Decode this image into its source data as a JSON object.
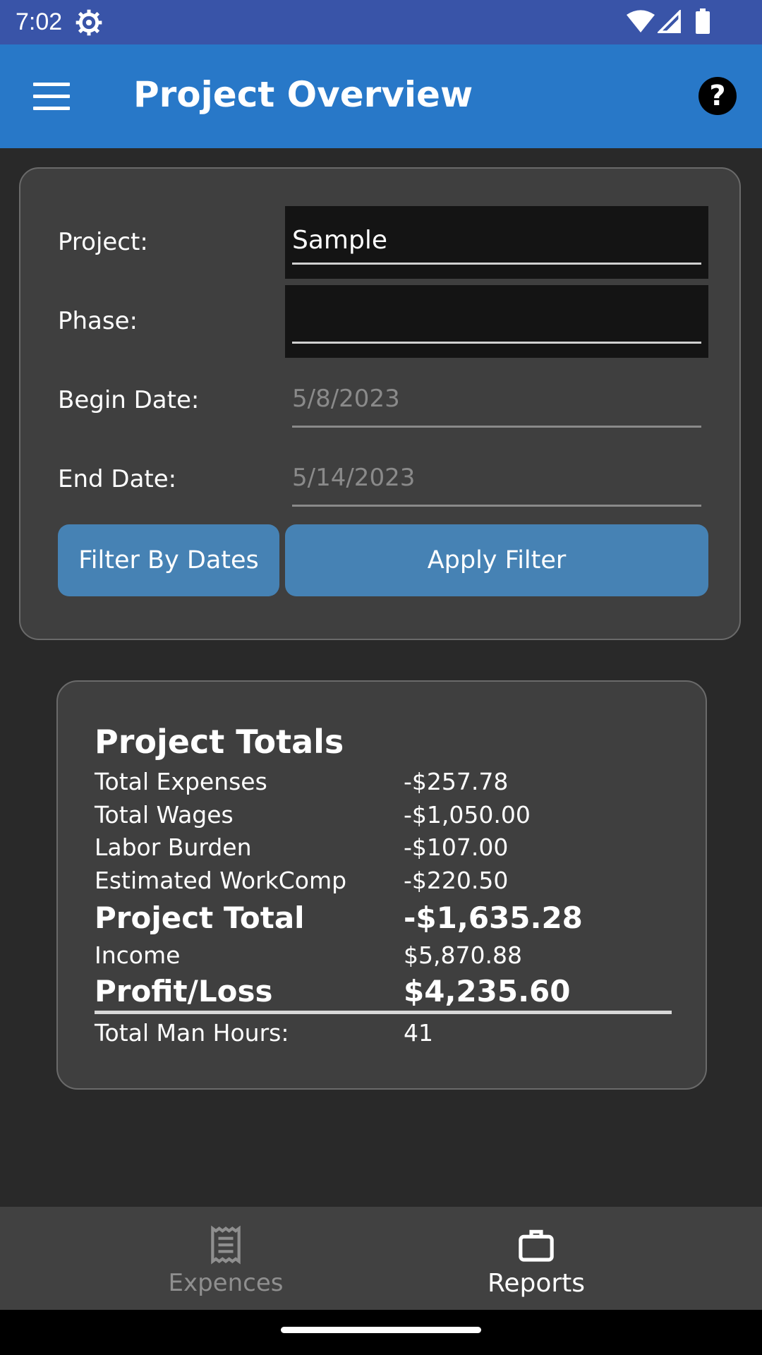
{
  "status": {
    "time": "7:02",
    "icons": [
      "gear-icon",
      "wifi-icon",
      "signal-icon",
      "battery-icon"
    ]
  },
  "appbar": {
    "title": "Project Overview",
    "menu_icon": "hamburger-menu-icon",
    "help_icon": "help-icon",
    "help_glyph": "?"
  },
  "filter": {
    "project_label": "Project:",
    "project_value": "Sample",
    "phase_label": "Phase:",
    "phase_value": "",
    "begin_label": "Begin Date:",
    "begin_value": "5/8/2023",
    "end_label": "End Date:",
    "end_value": "5/14/2023",
    "filter_dates_button": "Filter By Dates",
    "apply_button": "Apply Filter"
  },
  "totals": {
    "title": "Project Totals",
    "rows": [
      {
        "label": "Total Expenses",
        "value": "-$257.78"
      },
      {
        "label": "Total Wages",
        "value": "-$1,050.00"
      },
      {
        "label": "Labor Burden",
        "value": "-$107.00"
      },
      {
        "label": "Estimated WorkComp",
        "value": "-$220.50"
      },
      {
        "label": "Project Total",
        "value": "-$1,635.28"
      },
      {
        "label": "Income",
        "value": "$5,870.88"
      },
      {
        "label": "Profit/Loss",
        "value": "$4,235.60"
      },
      {
        "label": "Total Man Hours:",
        "value": "41"
      }
    ]
  },
  "bottomnav": {
    "items": [
      {
        "label": "Expences",
        "icon": "receipt-icon",
        "active": false
      },
      {
        "label": "Reports",
        "icon": "briefcase-icon",
        "active": true
      }
    ]
  },
  "colors": {
    "statusbar": "#3954a8",
    "appbar": "#2878c8",
    "button": "#4682b4",
    "background": "#292929",
    "card": "#3f3f3f"
  }
}
